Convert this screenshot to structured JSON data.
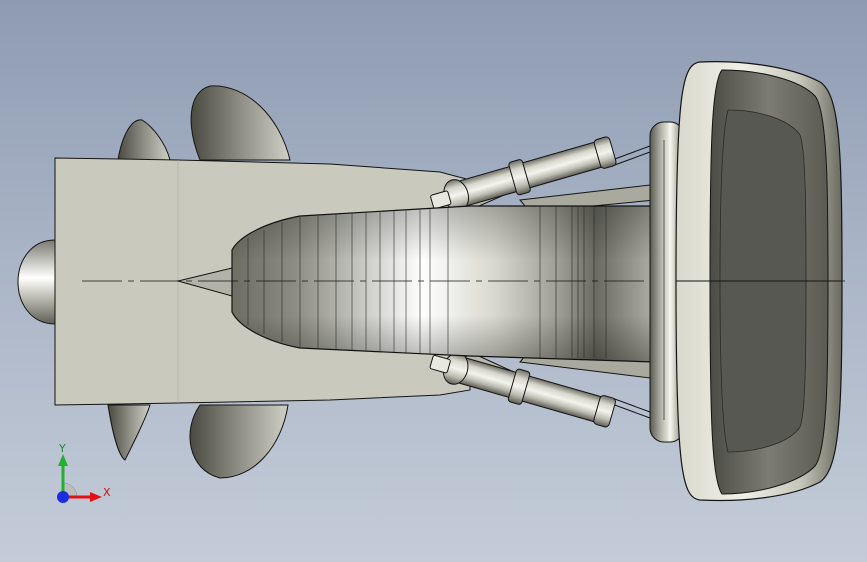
{
  "viewport": {
    "background_top": "#8e9bb1",
    "background_bottom": "#c4ccd8",
    "model_color": "#c9c9bd",
    "edge_color": "#141414"
  },
  "triad": {
    "x_label": "X",
    "y_label": "Y",
    "x_color": "#e01212",
    "y_color": "#22b02e",
    "z_color": "#1a2ee0",
    "icon": "coordinate-axes-icon"
  }
}
